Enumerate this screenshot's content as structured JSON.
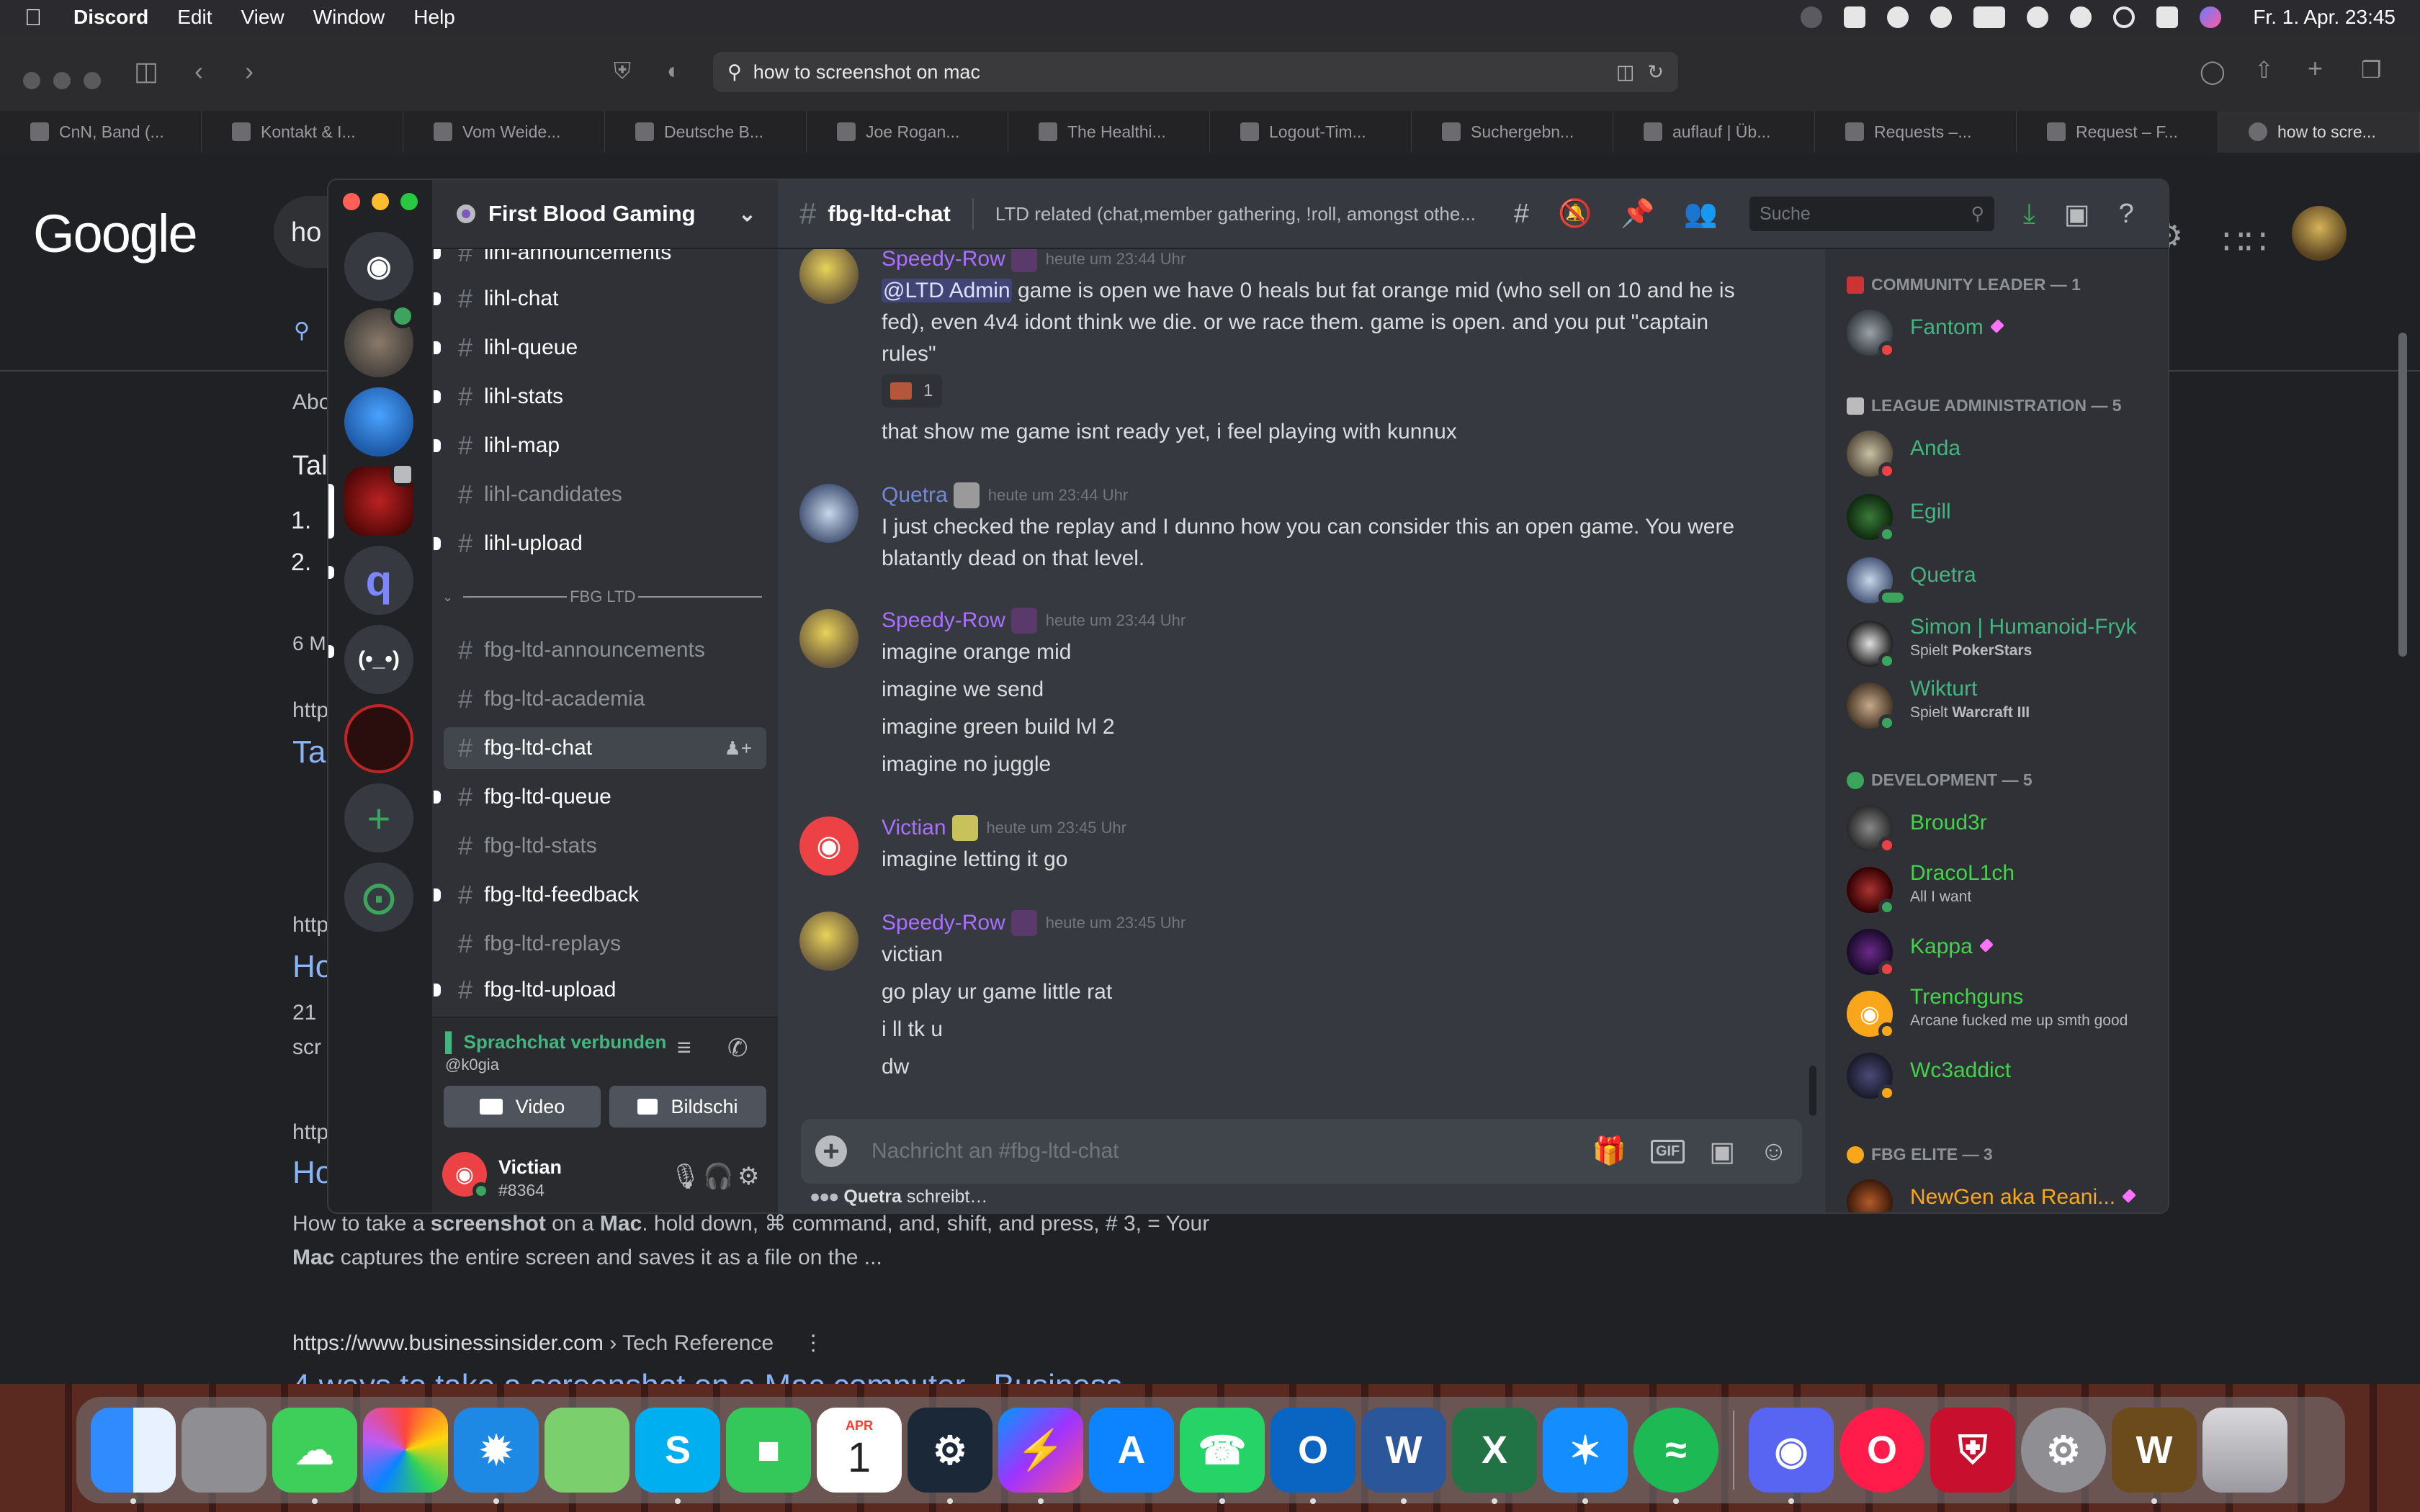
{
  "menubar": {
    "app": "Discord",
    "items": [
      "Edit",
      "View",
      "Window",
      "Help"
    ],
    "clock": "Fr. 1. Apr. 23:45"
  },
  "safari": {
    "url": "how to screenshot on mac",
    "tabs": [
      "CnN, Band (...",
      "Kontakt & I...",
      "Vom Weide...",
      "Deutsche B...",
      "Joe Rogan...",
      "The Healthi...",
      "Logout-Tim...",
      "Suchergebn...",
      "auflauf | Üb...",
      "Requests –...",
      "Request – F...",
      "how to scre..."
    ]
  },
  "google": {
    "logo": "Google",
    "search_fragment": "ho",
    "fragments": [
      "Abo",
      "Tal",
      "1.",
      "2.",
      "6 M",
      "http",
      "Ta",
      "http",
      "Ho",
      "21",
      "scr",
      "http",
      "Ho"
    ],
    "snippet_line1_pre": "How to take a ",
    "snippet_line1_b1": "screenshot",
    "snippet_line1_mid": " on a ",
    "snippet_line1_b2": "Mac",
    "snippet_line1_post": ". hold down, ⌘ command, and, shift, and press, # 3, = Your",
    "snippet_line2_b": "Mac",
    "snippet_line2_post": " captures the entire screen and saves it as a file on the ...",
    "result_url": "https://www.businessinsider.com",
    "result_crumb": " › Tech Reference",
    "result_title": "4 ways to take a screenshot on a Mac computer - Business"
  },
  "dock": {
    "apps": [
      "Finder",
      "Launchpad",
      "Messages",
      "Photos",
      "Safari",
      "Maps",
      "Skype",
      "FaceTime",
      "Calendar",
      "Steam",
      "Messenger",
      "App Store",
      "WhatsApp",
      "Outlook",
      "Word",
      "Excel",
      "Battle.net",
      "Spotify",
      "Discord",
      "Opera GX",
      "Bitwarden",
      "System Preferences",
      "Warcraft III",
      "Trash"
    ],
    "calendar_month": "APR",
    "calendar_day": "1"
  },
  "discord": {
    "guild": "First Blood Gaming",
    "channels": [
      {
        "name": "lihl-announcements",
        "unread": true
      },
      {
        "name": "lihl-chat",
        "unread": true
      },
      {
        "name": "lihl-queue",
        "unread": true
      },
      {
        "name": "lihl-stats",
        "unread": true
      },
      {
        "name": "lihl-map",
        "unread": true
      },
      {
        "name": "lihl-candidates",
        "unread": false
      },
      {
        "name": "lihl-upload",
        "unread": true
      }
    ],
    "category": "FBG LTD",
    "ltd_channels": [
      {
        "name": "fbg-ltd-announcements",
        "unread": false
      },
      {
        "name": "fbg-ltd-academia",
        "unread": false
      },
      {
        "name": "fbg-ltd-chat",
        "unread": true,
        "selected": true
      },
      {
        "name": "fbg-ltd-queue",
        "unread": true
      },
      {
        "name": "fbg-ltd-stats",
        "unread": false
      },
      {
        "name": "fbg-ltd-feedback",
        "unread": true
      },
      {
        "name": "fbg-ltd-replays",
        "unread": false
      },
      {
        "name": "fbg-ltd-upload",
        "unread": true
      }
    ],
    "voice": {
      "status": "Sprachchat verbunden",
      "channel": "@k0gia",
      "video_label": "Video",
      "screen_label": "Bildschi"
    },
    "user": {
      "name": "Victian",
      "tag": "#8364"
    },
    "header": {
      "channel": "fbg-ltd-chat",
      "topic": "LTD related (chat,member gathering, !roll, amongst othe...",
      "search_placeholder": "Suche"
    },
    "messages": [
      {
        "author": "Speedy-Row",
        "time": "heute um 23:44 Uhr",
        "mention": "@LTD Admin",
        "lines": [
          " game is open we have 0 heals but fat orange mid (who sell on 10 and he is fed), even 4v4 idont think we die. or we race them. game is open. and you put \"captain rules\""
        ],
        "reaction_count": "1",
        "followup": "that show me game isnt ready yet, i feel playing with kunnux"
      },
      {
        "author": "Quetra",
        "time": "heute um 23:44 Uhr",
        "lines": [
          "I just checked the replay and I dunno how you can consider this an open game. You were blatantly dead on that level."
        ]
      },
      {
        "author": "Speedy-Row",
        "time": "heute um 23:44 Uhr",
        "lines": [
          "imagine orange mid",
          "imagine we send",
          "imagine green build lvl 2",
          "imagine no juggle"
        ]
      },
      {
        "author": "Victian",
        "time": "heute um 23:45 Uhr",
        "lines": [
          "imagine letting it go"
        ]
      },
      {
        "author": "Speedy-Row",
        "time": "heute um 23:45 Uhr",
        "lines": [
          "victian",
          "go play ur game little rat",
          "i ll tk u",
          "dw"
        ]
      }
    ],
    "composer_placeholder": "Nachricht an #fbg-ltd-chat",
    "composer_gif": "GIF",
    "typing_user": "Quetra",
    "typing_suffix": " schreibt…",
    "member_groups": [
      {
        "title": "COMMUNITY LEADER — 1",
        "members": [
          {
            "name": "Fantom",
            "color": "#43b581",
            "status": "dnd",
            "boost": true
          }
        ]
      },
      {
        "title": "LEAGUE ADMINISTRATION — 5",
        "members": [
          {
            "name": "Anda",
            "color": "#43b581",
            "status": "dnd"
          },
          {
            "name": "Egill",
            "color": "#43b581",
            "status": "online"
          },
          {
            "name": "Quetra",
            "color": "#43b581",
            "status": "typing"
          },
          {
            "name": "Simon | Humanoid-Fryk",
            "color": "#43b581",
            "status": "online",
            "activity_pre": "Spielt ",
            "activity": "PokerStars"
          },
          {
            "name": "Wikturt",
            "color": "#43b581",
            "status": "online",
            "activity_pre": "Spielt ",
            "activity": "Warcraft III"
          }
        ]
      },
      {
        "title": "DEVELOPMENT — 5",
        "members": [
          {
            "name": "Broud3r",
            "color": "#43d34a",
            "status": "dnd"
          },
          {
            "name": "DracoL1ch",
            "color": "#43d34a",
            "status": "online",
            "activity_pre": "",
            "activity": "All I want"
          },
          {
            "name": "Kappa",
            "color": "#43d34a",
            "status": "dnd",
            "boost": true
          },
          {
            "name": "Trenchguns",
            "color": "#43d34a",
            "status": "idle",
            "activity_pre": "",
            "activity": "Arcane fucked me up smth good"
          },
          {
            "name": "Wc3addict",
            "color": "#43d34a",
            "status": "idle"
          }
        ]
      },
      {
        "title": "FBG ELITE — 3",
        "members": [
          {
            "name": "NewGen aka Reani...",
            "color": "#faa61a",
            "status": "online",
            "boost": true
          }
        ]
      }
    ]
  }
}
